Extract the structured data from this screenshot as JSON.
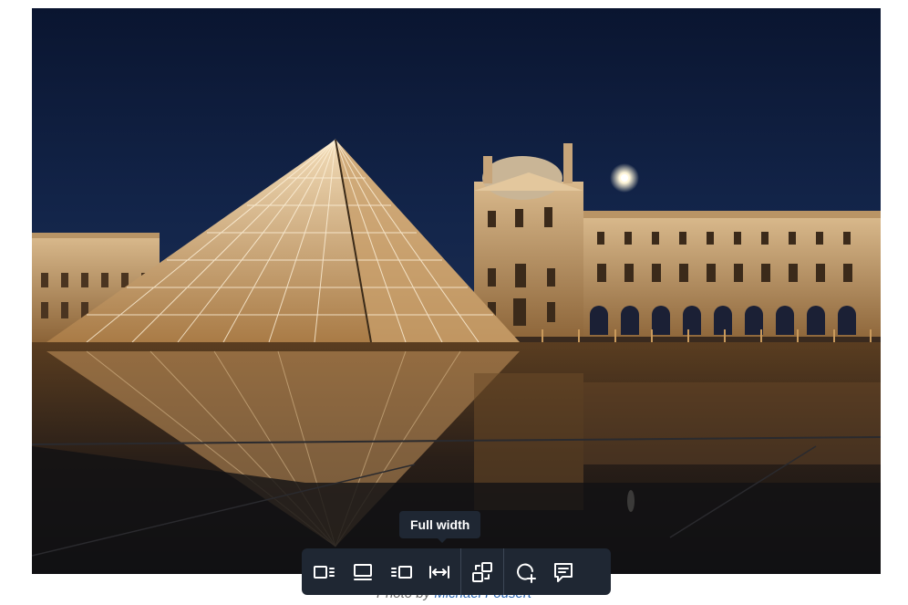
{
  "photo": {
    "alt": "Louvre pyramid at night"
  },
  "caption": {
    "prefix": "Photo by ",
    "author": "Michael Fousert"
  },
  "tooltip": {
    "text": "Full width"
  },
  "toolbar": {
    "buttons": [
      {
        "icon": "align-left-icon"
      },
      {
        "icon": "wide-icon"
      },
      {
        "icon": "align-right-icon"
      },
      {
        "icon": "full-width-icon"
      },
      {
        "icon": "replace-image-icon"
      },
      {
        "icon": "add-link-icon"
      },
      {
        "icon": "caption-icon"
      }
    ]
  }
}
